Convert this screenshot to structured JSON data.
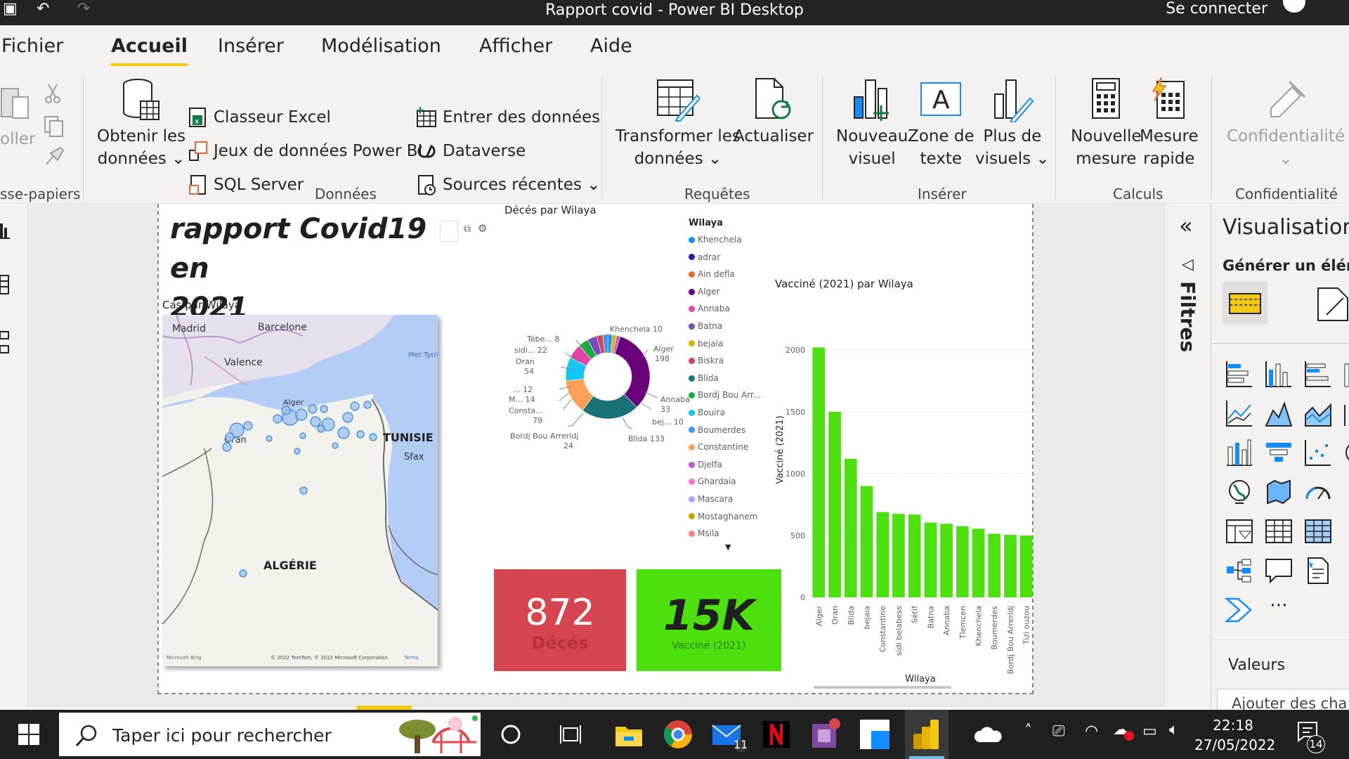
{
  "titlebar": {
    "title": "Rapport covid - Power BI Desktop",
    "signin": "Se connecter"
  },
  "tabs": [
    "Fichier",
    "Accueil",
    "Insérer",
    "Modélisation",
    "Afficher",
    "Aide"
  ],
  "ribbon": {
    "clipboard": {
      "paste_label": "oller",
      "group": "sse-papiers"
    },
    "data": {
      "get_data": [
        "Obtenir les",
        "données ⌄"
      ],
      "excel": "Classeur Excel",
      "pbi_datasets": "Jeux de données Power BI",
      "sql": "SQL Server",
      "enter": "Entrer des données",
      "dataverse": "Dataverse",
      "recent": "Sources récentes ⌄",
      "group": "Données"
    },
    "queries": {
      "transform": [
        "Transformer les",
        "données ⌄"
      ],
      "refresh": "Actualiser",
      "group": "Requêtes"
    },
    "insert": {
      "new_visual": [
        "Nouveau",
        "visuel"
      ],
      "textbox": [
        "Zone de",
        "texte"
      ],
      "more_visuals": [
        "Plus de",
        "visuels ⌄"
      ],
      "group": "Insérer"
    },
    "calc": {
      "new_measure": [
        "Nouvelle",
        "mesure"
      ],
      "quick_measure": [
        "Mesure",
        "rapide"
      ],
      "group": "Calculs"
    },
    "conf": {
      "label": "Confidentialité",
      "arrow": "⌄",
      "group": "Confidentialité"
    }
  },
  "report": {
    "title_line1": "rapport Covid19 en",
    "title_line2": "2021",
    "map": {
      "title": "Cas par Wilaya",
      "labels": {
        "madrid": "Madrid",
        "barcelone": "Barcelone",
        "valence": "Valence",
        "mer": "Mer Tyrrl",
        "alger": "Alger",
        "oran": "Oran",
        "tunisie": "TUNISIE",
        "sfax": "Sfax",
        "algerie": "ALGÉRIE"
      },
      "bing": "Microsoft Bing",
      "copyright": "© 2022 TomTom, © 2022 Microsoft Corporation",
      "terms": "Terms"
    },
    "donut": {
      "title": "Décés par Wilaya",
      "labels": [
        "Khenchela 10",
        "Alger",
        "198",
        "Annaba",
        "33",
        "bej... 10",
        "Blida 133",
        "Bordj Bou Arreridj",
        "24",
        "Consta...",
        "79",
        "M... 14",
        "... 12",
        "Oran",
        "54",
        "sidi... 22",
        "Tébe... 8"
      ]
    },
    "legend": {
      "title": "Wilaya",
      "items": [
        {
          "label": "Khenchela",
          "color": "#118dff"
        },
        {
          "label": "adrar",
          "color": "#12239e"
        },
        {
          "label": "Ain defla",
          "color": "#e66c37"
        },
        {
          "label": "Alger",
          "color": "#6b007b"
        },
        {
          "label": "Annaba",
          "color": "#e044a7"
        },
        {
          "label": "Batna",
          "color": "#744ec2"
        },
        {
          "label": "bejaia",
          "color": "#d9b300"
        },
        {
          "label": "Biskra",
          "color": "#d64550"
        },
        {
          "label": "Blida",
          "color": "#197278"
        },
        {
          "label": "Bordj Bou Arr...",
          "color": "#1aab40"
        },
        {
          "label": "Bouira",
          "color": "#15c6f4"
        },
        {
          "label": "Boumerdes",
          "color": "#4092ff"
        },
        {
          "label": "Constantine",
          "color": "#ffa058"
        },
        {
          "label": "Djelfa",
          "color": "#be5dc9"
        },
        {
          "label": "Ghardaia",
          "color": "#f472d0"
        },
        {
          "label": "Mascara",
          "color": "#b5a1ff"
        },
        {
          "label": "Mostaghanem",
          "color": "#c4a200"
        },
        {
          "label": "Msila",
          "color": "#ff8080"
        }
      ]
    },
    "card_deaths": {
      "value": "872",
      "label": "Décés",
      "color": "#d64550"
    },
    "card_vaccinated": {
      "value": "15K",
      "label": "Vacciné (2021)",
      "color": "#4ce10e"
    }
  },
  "chart_data": [
    {
      "type": "pie",
      "title": "Décés par Wilaya",
      "categories": [
        "Alger",
        "Blida",
        "Constantine",
        "Oran",
        "Annaba",
        "Bordj Bou Arreridj",
        "sidi...",
        "M...",
        "...",
        "Khenchela",
        "bej...",
        "Tébe..."
      ],
      "values": [
        198,
        133,
        79,
        54,
        33,
        24,
        22,
        14,
        12,
        10,
        10,
        8
      ]
    },
    {
      "type": "bar",
      "title": "Vacciné (2021) par Wilaya",
      "xlabel": "Wilaya",
      "ylabel": "Vacciné (2021)",
      "categories": [
        "Alger",
        "Oran",
        "Blida",
        "bejaia",
        "Constantine",
        "sidi belabess",
        "Sétif",
        "Batna",
        "Annaba",
        "Tlemcen",
        "Khenchela",
        "Boumerdes",
        "Bordj Bou Arreridj",
        "Tizi ouzou"
      ],
      "values": [
        2020,
        1500,
        1120,
        900,
        690,
        675,
        670,
        605,
        595,
        575,
        555,
        515,
        505,
        500
      ],
      "yticks": [
        "0",
        "500",
        "1000",
        "1500",
        "2000"
      ],
      "ylim": [
        0,
        2000
      ],
      "color": "#4ce10e"
    }
  ],
  "panes": {
    "filters": "Filtres",
    "viz_title": "Visualisation",
    "viz_sub": "Générer un élém",
    "values": "Valeurs",
    "add_fields": "Ajouter des cha"
  },
  "taskbar": {
    "search": "Taper ici pour rechercher",
    "time": "22:18",
    "date": "27/05/2022",
    "mail_badge": "11",
    "notif_badge": "14"
  }
}
